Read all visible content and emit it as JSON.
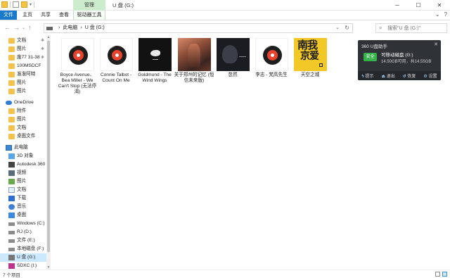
{
  "window": {
    "title": "U 盘 (G:)",
    "context_tab": "管理",
    "controls": [
      "─",
      "☐",
      "✕"
    ]
  },
  "ribbon": {
    "tabs": [
      "文件",
      "主页",
      "共享",
      "查看",
      "驱动器工具"
    ],
    "right_icons": [
      "chevron-down-icon",
      "help-icon"
    ]
  },
  "address": {
    "breadcrumbs": [
      "此电脑",
      "›",
      "U 盘 (G:)"
    ],
    "search_placeholder": "搜索\"U 盘 (G:)\""
  },
  "nav": {
    "items": [
      {
        "label": "文档",
        "icon": "folder-icon",
        "pinned": true
      },
      {
        "label": "图片",
        "icon": "folder-icon",
        "pinned": true
      },
      {
        "label": "废77 31-38",
        "icon": "folder-icon",
        "pinned": true
      },
      {
        "label": "100MSDCF",
        "icon": "folder-icon",
        "pinned": false
      },
      {
        "label": "准准阿特",
        "icon": "folder-icon",
        "pinned": false
      },
      {
        "label": "图片",
        "icon": "folder-icon",
        "pinned": false
      },
      {
        "label": "图片",
        "icon": "folder-icon",
        "pinned": false
      },
      {
        "label": "OneDrive",
        "icon": "cloud-icon",
        "pinned": false
      },
      {
        "label": "附件",
        "icon": "folder-icon",
        "pinned": false
      },
      {
        "label": "图片",
        "icon": "folder-icon",
        "pinned": false
      },
      {
        "label": "文档",
        "icon": "folder-icon",
        "pinned": false
      },
      {
        "label": "桌面文件",
        "icon": "folder-icon",
        "pinned": false
      },
      {
        "label": "此电脑",
        "icon": "pc-icon",
        "pinned": false
      },
      {
        "label": "3D 对象",
        "icon": "3d-objects-icon",
        "pinned": false
      },
      {
        "label": "Autodesk 360",
        "icon": "app-icon",
        "pinned": false
      },
      {
        "label": "视频",
        "icon": "video-icon",
        "pinned": false
      },
      {
        "label": "图片",
        "icon": "image-icon",
        "pinned": false
      },
      {
        "label": "文档",
        "icon": "document-icon",
        "pinned": false
      },
      {
        "label": "下载",
        "icon": "download-icon",
        "pinned": false
      },
      {
        "label": "音乐",
        "icon": "music-icon",
        "pinned": false
      },
      {
        "label": "桌面",
        "icon": "desktop-icon",
        "pinned": false
      },
      {
        "label": "Windows (C:)",
        "icon": "drive-icon",
        "pinned": false
      },
      {
        "label": "RJ (D:)",
        "icon": "drive-icon",
        "pinned": false
      },
      {
        "label": "文件 (E:)",
        "icon": "drive-icon",
        "pinned": false
      },
      {
        "label": "本地磁盘 (F:)",
        "icon": "drive-icon",
        "pinned": false
      },
      {
        "label": "U 盘 (G:)",
        "icon": "usb-drive-icon",
        "pinned": false,
        "selected": true
      },
      {
        "label": "SDXC (I:)",
        "icon": "sd-card-icon",
        "pinned": false
      }
    ]
  },
  "files": [
    {
      "name": "Boyce Avenue、Bea Miller - We Can't Stop (无法停渴)",
      "thumb": "disc"
    },
    {
      "name": "Connie Talbot - Count On Me",
      "thumb": "disc"
    },
    {
      "name": "Goldmund - The Wind Wings",
      "thumb": "art-a"
    },
    {
      "name": "关于郑州的记忆 (恒信未来版)",
      "thumb": "art-b"
    },
    {
      "name": "忽然",
      "thumb": "art-c"
    },
    {
      "name": "李志 - 梵高先生",
      "thumb": "disc"
    },
    {
      "name": "天空之城",
      "thumb": "art-d"
    }
  ],
  "album_d": {
    "line1": "南我",
    "line2": "京爱"
  },
  "widget360": {
    "title": "360 U盘助手",
    "close": "✕",
    "badge": "安全",
    "drive": "可移动磁盘 (G:)",
    "space": "14.50GB可用，共14.55GB",
    "actions": [
      {
        "icon": "lightning-icon",
        "label": "提示"
      },
      {
        "icon": "eject-icon",
        "label": "退出"
      },
      {
        "icon": "restore-icon",
        "label": "恢复"
      },
      {
        "icon": "settings-icon",
        "label": "设置"
      }
    ]
  },
  "status": {
    "count": "7 个项目"
  },
  "colors": {
    "accent": "#1979ca",
    "selection": "#cce8ff",
    "context_tab": "#cdeccd",
    "widget_bg": "#2f3237",
    "safe_green": "#36b24a"
  }
}
